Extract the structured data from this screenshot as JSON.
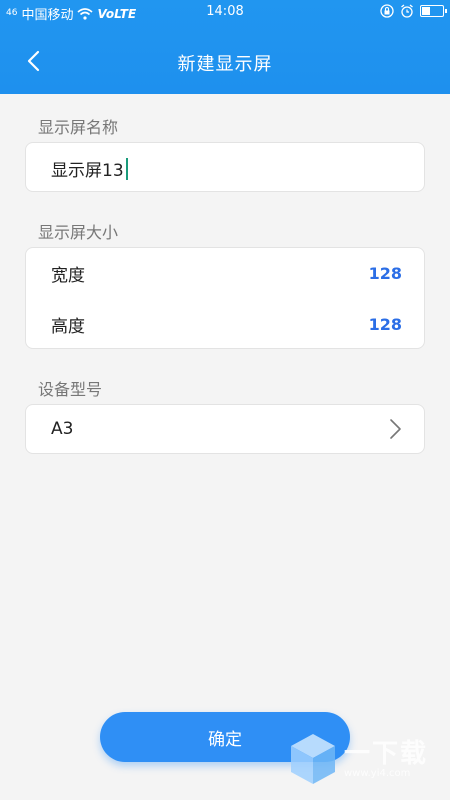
{
  "status_bar": {
    "carrier": "中国移动",
    "network": "VoLTE",
    "signal_text": "46",
    "time": "14:08"
  },
  "nav": {
    "title": "新建显示屏"
  },
  "name_section": {
    "label": "显示屏名称",
    "value": "显示屏13"
  },
  "size_section": {
    "label": "显示屏大小",
    "rows": [
      {
        "label": "宽度",
        "value": "128"
      },
      {
        "label": "高度",
        "value": "128"
      }
    ]
  },
  "device_section": {
    "label": "设备型号",
    "value": "A3"
  },
  "confirm_button": {
    "label": "确定"
  },
  "watermark": {
    "text": "一下载",
    "url": "www.yi4.com"
  },
  "colors": {
    "header": "#1e90ee",
    "accent_value": "#2b6ee6",
    "button": "#2f8ff5",
    "background": "#f4f4f4"
  }
}
